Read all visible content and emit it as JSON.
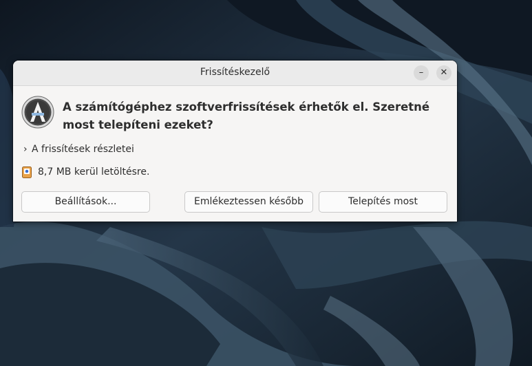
{
  "window": {
    "title": "Frissítéskezelő",
    "minimize_glyph": "–",
    "close_glyph": "✕"
  },
  "dialog": {
    "app_icon": "update-manager-icon",
    "headline": "A számítógéphez szoftverfrissítések érhetők el. Szeretné most telepíteni ezeket?",
    "details_chevron": "›",
    "details_label": "A frissítések részletei",
    "download_icon": "download-package-icon",
    "download_text": "8,7 MB kerül letöltésre."
  },
  "buttons": {
    "settings": "Beállítások...",
    "remind_later": "Emlékeztessen később",
    "install_now": "Telepítés most"
  },
  "colors": {
    "window_bg": "#f6f5f4",
    "titlebar_bg": "#ebebeb",
    "text": "#2e2e2e",
    "desktop_bg": "#1a2632"
  }
}
